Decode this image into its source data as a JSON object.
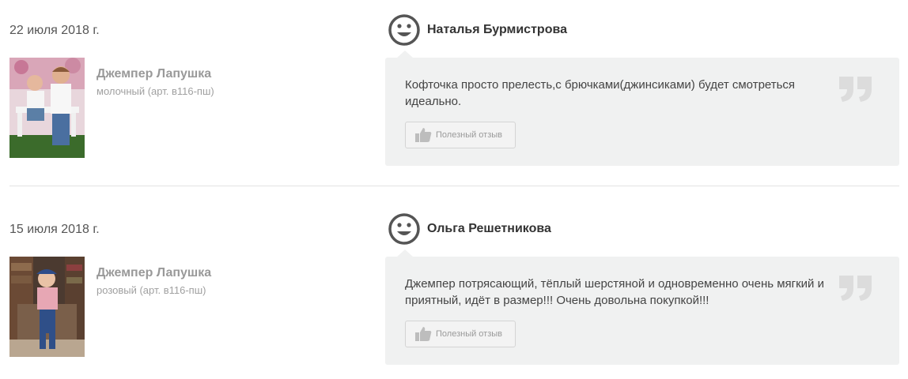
{
  "reviews": [
    {
      "date": "22 июля 2018 г.",
      "product_name": "Джемпер Лапушка",
      "product_variant": "молочный (арт. в116-пш)",
      "author": "Наталья Бурмистрова",
      "text": "Кофточка просто прелесть,с брючками(джинсиками) будет смотреться идеально.",
      "useful_label": "Полезный отзыв",
      "avatar_icon": "smiley-icon",
      "quote_icon": "quote-icon"
    },
    {
      "date": "15 июля 2018 г.",
      "product_name": "Джемпер Лапушка",
      "product_variant": "розовый (арт. в116-пш)",
      "author": "Ольга Решетникова",
      "text": "Джемпер потрясающий, тёплый шерстяной и одновременно очень мягкий и приятный, идёт в размер!!! Очень довольна покупкой!!!",
      "useful_label": "Полезный отзыв",
      "avatar_icon": "smiley-icon",
      "quote_icon": "quote-icon"
    }
  ],
  "colors": {
    "bubble_bg": "#f0f1f1",
    "muted_text": "#999999",
    "icon_gray": "#555555"
  }
}
